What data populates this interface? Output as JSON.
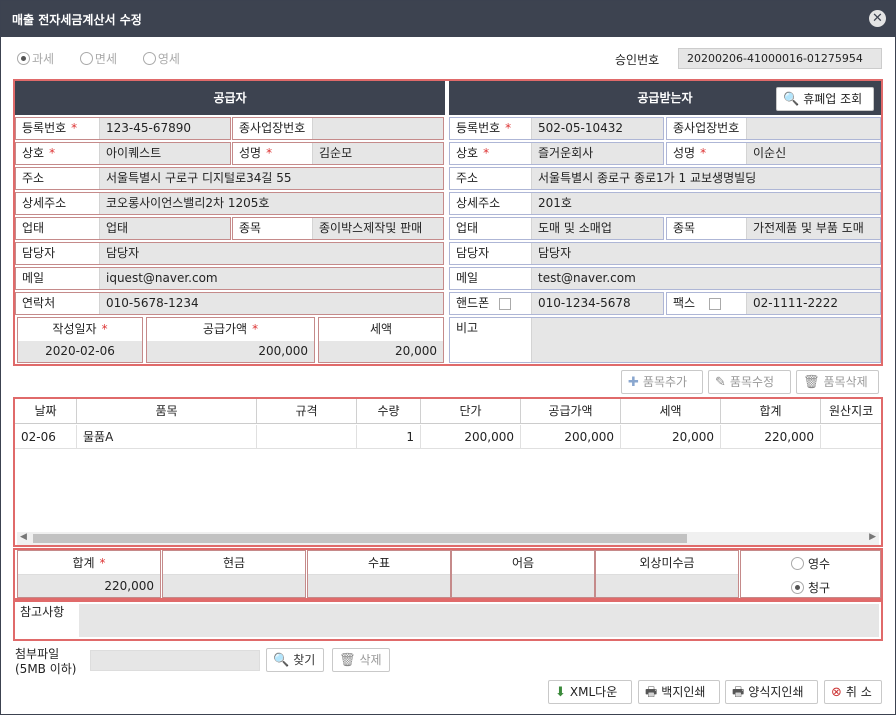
{
  "window": {
    "title": "매출 전자세금계산서 수정"
  },
  "tax_type": {
    "options": [
      "과세",
      "면세",
      "영세"
    ],
    "selected": "과세"
  },
  "approval": {
    "label": "승인번호",
    "value": "20200206-41000016-01275954"
  },
  "supplier": {
    "header": "공급자",
    "reg_no_label": "등록번호",
    "reg_no": "123-45-67890",
    "branch_label": "종사업장번호",
    "branch": "",
    "name_label": "상호",
    "name": "아이퀘스트",
    "ceo_label": "성명",
    "ceo": "김순모",
    "addr_label": "주소",
    "addr": "서울특별시 구로구 디지털로34길 55",
    "addr2_label": "상세주소",
    "addr2": "코오롱사이언스밸리2차 1205호",
    "biz_label": "업태",
    "biz": "업태",
    "item_label": "종목",
    "item": "종이박스제작및 판매",
    "manager_label": "담당자",
    "manager": "담당자",
    "email_label": "메일",
    "email": "iquest@naver.com",
    "phone_label": "연락처",
    "phone": "010-5678-1234"
  },
  "buyer": {
    "header": "공급받는자",
    "lookup_button": "휴폐업 조회",
    "reg_no_label": "등록번호",
    "reg_no": "502-05-10432",
    "branch_label": "종사업장번호",
    "branch": "",
    "name_label": "상호",
    "name": "즐거운회사",
    "ceo_label": "성명",
    "ceo": "이순신",
    "addr_label": "주소",
    "addr": "서울특별시 종로구 종로1가 1 교보생명빌딩",
    "addr2_label": "상세주소",
    "addr2": "201호",
    "biz_label": "업태",
    "biz": "도매 및 소매업",
    "item_label": "종목",
    "item": "가전제품 및 부품 도매",
    "manager_label": "담당자",
    "manager": "담당자",
    "email_label": "메일",
    "email": "test@naver.com",
    "mobile_label": "핸드폰",
    "mobile": "010-1234-5678",
    "fax_label": "팩스",
    "fax": "02-1111-2222",
    "note_label": "비고",
    "note": ""
  },
  "totals": {
    "date_label": "작성일자",
    "date": "2020-02-06",
    "supply_label": "공급가액",
    "supply": "200,000",
    "tax_label": "세액",
    "tax": "20,000"
  },
  "item_buttons": {
    "add": "품목추가",
    "edit": "품목수정",
    "delete": "품목삭제"
  },
  "table": {
    "columns": [
      "날짜",
      "품목",
      "규격",
      "수량",
      "단가",
      "공급가액",
      "세액",
      "합계",
      "원산지코"
    ],
    "rows": [
      [
        "02-06",
        "물품A",
        "",
        "1",
        "200,000",
        "200,000",
        "20,000",
        "220,000",
        ""
      ]
    ]
  },
  "payment": {
    "total_label": "합계",
    "total": "220,000",
    "cash_label": "현금",
    "cash": "",
    "check_label": "수표",
    "check": "",
    "note_label": "어음",
    "note": "",
    "credit_label": "외상미수금",
    "credit": "",
    "receipt_label": "영수",
    "claim_label": "청구",
    "selected": "청구"
  },
  "memo": {
    "label": "참고사항",
    "value": ""
  },
  "attach": {
    "label1": "첨부파일",
    "label2": "(5MB 이하)",
    "find": "찾기",
    "delete": "삭제"
  },
  "footer": {
    "xml": "XML다운",
    "plain_print": "백지인쇄",
    "form_print": "양식지인쇄",
    "cancel": "취 소"
  }
}
